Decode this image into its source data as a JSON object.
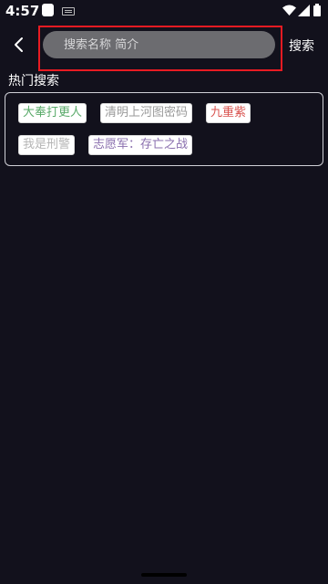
{
  "status_bar": {
    "time": "4:57",
    "icons": [
      "app-notification-icon",
      "keyboard-icon",
      "wifi-icon",
      "signal-icon",
      "battery-icon"
    ]
  },
  "toolbar": {
    "back_icon": "chevron-left-icon",
    "search_placeholder": "搜索名称 简介",
    "search_value": "",
    "search_button_label": "搜索",
    "highlight_color": "#e81b22"
  },
  "hot_search": {
    "title": "热门搜索",
    "tags": [
      {
        "label": "大奉打更人",
        "color": "#5aaa6a"
      },
      {
        "label": "清明上河图密码",
        "color": "#9a9a9a"
      },
      {
        "label": "九重紫",
        "color": "#d9534f"
      },
      {
        "label": "我是刑警",
        "color": "#b5b5b5"
      },
      {
        "label": "志愿军：存亡之战",
        "color": "#8a6fae"
      }
    ]
  },
  "colors": {
    "background": "#12111c",
    "search_box": "#6c6c70",
    "panel_border": "#cfcfd6"
  }
}
